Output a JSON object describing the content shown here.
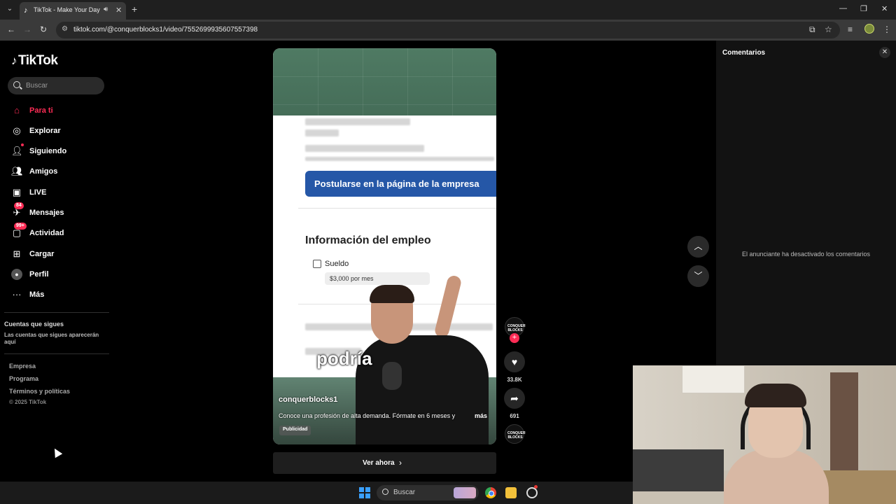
{
  "browser": {
    "tab_title": "TikTok - Make Your Day",
    "url": "tiktok.com/@conquerblocks1/video/7552699935607557398"
  },
  "sidebar": {
    "logo": "TikTok",
    "search_placeholder": "Buscar",
    "nav": [
      {
        "label": "Para ti",
        "icon": "home-icon",
        "active": true
      },
      {
        "label": "Explorar",
        "icon": "compass-icon"
      },
      {
        "label": "Siguiendo",
        "icon": "following-icon"
      },
      {
        "label": "Amigos",
        "icon": "friends-icon"
      },
      {
        "label": "LIVE",
        "icon": "live-icon"
      },
      {
        "label": "Mensajes",
        "icon": "messages-icon",
        "badge": "84"
      },
      {
        "label": "Actividad",
        "icon": "activity-icon",
        "badge": "99+"
      },
      {
        "label": "Cargar",
        "icon": "upload-icon"
      },
      {
        "label": "Perfil",
        "icon": "profile-avatar"
      },
      {
        "label": "Más",
        "icon": "more-icon"
      }
    ],
    "accounts_title": "Cuentas que sigues",
    "accounts_desc": "Las cuentas que sigues aparecerán aquí",
    "footer_links": [
      "Empresa",
      "Programa",
      "Términos y políticas"
    ],
    "copyright": "© 2025 TikTok"
  },
  "video": {
    "apply_button": "Postularse en la página de la empresa",
    "job_info_title": "Información del empleo",
    "salary_label": "Sueldo",
    "salary_value": "$3,000 por mes",
    "caption_word": "podría",
    "author": "conquerblocks1",
    "description": "Conoce una profesión de alta demanda. Fórmate en 6 meses y",
    "more": "más",
    "ad_label": "Publicidad",
    "cta": "Ver ahora",
    "brand_mark": "CONQUER BLOCKS"
  },
  "actions": {
    "likes": "33.8K",
    "shares": "691"
  },
  "comments": {
    "title": "Comentarios",
    "disabled_message": "El anunciante ha desactivado los comentarios"
  },
  "taskbar": {
    "search_label": "Buscar"
  },
  "colors": {
    "accent": "#fe2c55",
    "apply_button": "#2557a7"
  }
}
